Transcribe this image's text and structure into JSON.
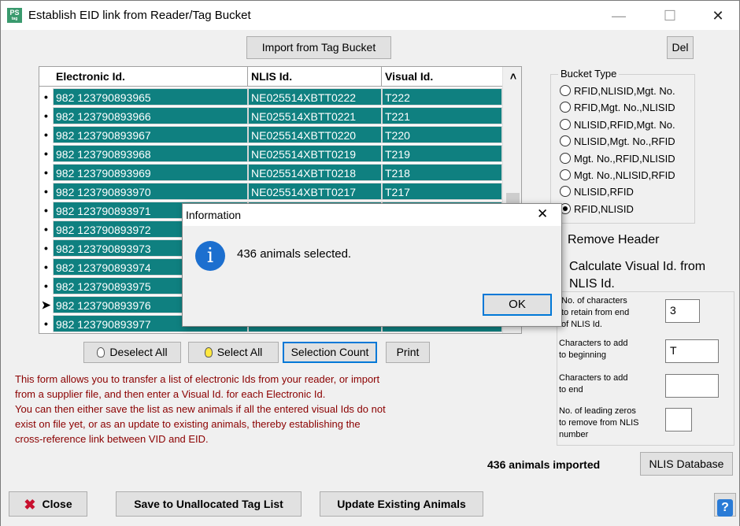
{
  "window": {
    "title": "Establish EID link from Reader/Tag Bucket",
    "icon_text": "PS",
    "icon_subtext": "tag",
    "minimize_icon": "minimize-icon",
    "maximize_icon": "maximize-icon",
    "close_icon": "close-icon"
  },
  "toolbar": {
    "import_label": "Import from Tag Bucket",
    "del_label": "Del"
  },
  "grid": {
    "columns": [
      "Electronic Id.",
      "NLIS Id.",
      "Visual Id."
    ],
    "rows": [
      {
        "indicator": "•",
        "eid": "982 123790893965",
        "nlis": "NE025514XBTT0222",
        "vid": "T222"
      },
      {
        "indicator": "•",
        "eid": "982 123790893966",
        "nlis": "NE025514XBTT0221",
        "vid": "T221"
      },
      {
        "indicator": "•",
        "eid": "982 123790893967",
        "nlis": "NE025514XBTT0220",
        "vid": "T220"
      },
      {
        "indicator": "•",
        "eid": "982 123790893968",
        "nlis": "NE025514XBTT0219",
        "vid": "T219"
      },
      {
        "indicator": "•",
        "eid": "982 123790893969",
        "nlis": "NE025514XBTT0218",
        "vid": "T218"
      },
      {
        "indicator": "•",
        "eid": "982 123790893970",
        "nlis": "NE025514XBTT0217",
        "vid": "T217"
      },
      {
        "indicator": "•",
        "eid": "982 123790893971",
        "nlis": "",
        "vid": ""
      },
      {
        "indicator": "•",
        "eid": "982 123790893972",
        "nlis": "",
        "vid": ""
      },
      {
        "indicator": "•",
        "eid": "982 123790893973",
        "nlis": "",
        "vid": ""
      },
      {
        "indicator": "•",
        "eid": "982 123790893974",
        "nlis": "",
        "vid": ""
      },
      {
        "indicator": "•",
        "eid": "982 123790893975",
        "nlis": "",
        "vid": ""
      },
      {
        "indicator": "➤",
        "eid": "982 123790893976",
        "nlis": "",
        "vid": ""
      },
      {
        "indicator": "•",
        "eid": "982 123790893977",
        "nlis": "",
        "vid": ""
      }
    ],
    "scroll_up_icon": "chevron-up-icon"
  },
  "actions": {
    "deselect_all": "Deselect All",
    "select_all": "Select All",
    "selection_count": "Selection Count",
    "print": "Print"
  },
  "info_text": [
    "This form allows you to transfer a list of electronic Ids from your reader, or import",
    "from a supplier file, and then enter a Visual Id. for each Electronic Id.",
    "You can then either save the list as new animals if all the entered visual Ids do not",
    "exist on file yet, or as an update to existing animals, thereby establishing the",
    "cross-reference link between VID and EID."
  ],
  "bucket_type": {
    "title": "Bucket Type",
    "options": [
      "RFID,NLISID,Mgt. No.",
      "RFID,Mgt. No.,NLISID",
      "NLISID,RFID,Mgt. No.",
      "NLISID,Mgt. No.,RFID",
      "Mgt. No.,RFID,NLISID",
      "Mgt. No.,NLISID,RFID",
      "NLISID,RFID",
      "RFID,NLISID"
    ],
    "selected": "RFID,NLISID"
  },
  "options": {
    "remove_header": "Remove Header",
    "calc_visual_line1": "Calculate Visual Id. from",
    "calc_visual_line2": "NLIS Id."
  },
  "visual_calc": {
    "retain_label_1": "No. of characters",
    "retain_label_2": "to retain from end",
    "retain_label_3": "of NLIS Id.",
    "retain_value": "3",
    "prefix_label_1": "Characters to add",
    "prefix_label_2": "to beginning",
    "prefix_value": "T",
    "suffix_label_1": "Characters to add",
    "suffix_label_2": "to end",
    "suffix_value": "",
    "zeros_label_1": "No. of leading zeros",
    "zeros_label_2": "to remove from NLIS",
    "zeros_label_3": "number",
    "zeros_value": ""
  },
  "status": {
    "imported": "436 animals imported",
    "nlis_db": "NLIS Database"
  },
  "footer": {
    "close": "Close",
    "save_unallocated": "Save to Unallocated Tag List",
    "update_existing": "Update Existing Animals",
    "help": "?"
  },
  "dialog": {
    "title": "Information",
    "message": "436 animals selected.",
    "ok": "OK",
    "icon_glyph": "i",
    "close_glyph": "✕"
  },
  "colors": {
    "row_highlight": "#0f8080",
    "info_text": "#8b0000",
    "accent": "#0078d7"
  }
}
